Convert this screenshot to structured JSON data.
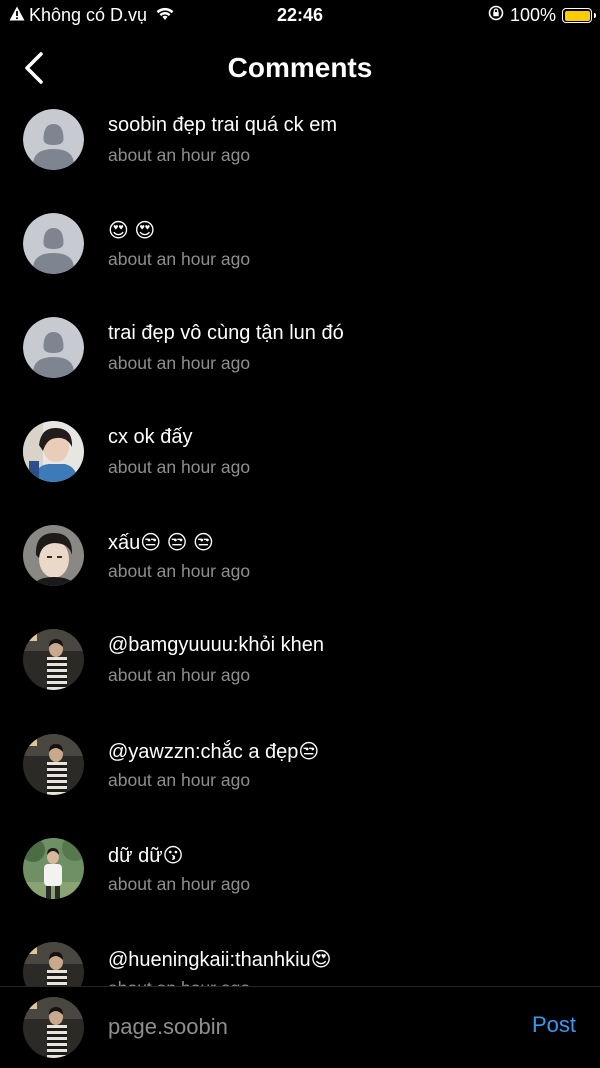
{
  "status_bar": {
    "carrier": "Không có D.vụ",
    "time": "22:46",
    "battery": "100%",
    "battery_level": 1.0,
    "battery_color": "#ffcc00"
  },
  "header": {
    "title": "Comments"
  },
  "comments": [
    {
      "text": "soobin đẹp trai quá ck em",
      "time": "about an hour ago",
      "avatar": "default-avatar"
    },
    {
      "text": "😍 😍",
      "time": "about an hour ago",
      "avatar": "default-avatar"
    },
    {
      "text": "trai đẹp vô cùng tận lun đó",
      "time": "about an hour ago",
      "avatar": "default-avatar"
    },
    {
      "text": "cx ok đấy",
      "time": "about an hour ago",
      "avatar": "photo-avatar"
    },
    {
      "text": "xấu😒 😒 😒",
      "time": "about an hour ago",
      "avatar": "photo-avatar"
    },
    {
      "text": "@bamgyuuuu:khỏi khen",
      "time": "about an hour ago",
      "avatar": "photo-avatar"
    },
    {
      "text": "@yawzzn:chắc a đẹp😒",
      "time": "about an hour ago",
      "avatar": "photo-avatar"
    },
    {
      "text": "dữ dữ😗",
      "time": "about an hour ago",
      "avatar": "photo-avatar"
    },
    {
      "text": "@hueningkaii:thanhkiu😍",
      "time": "about an hour ago",
      "avatar": "photo-avatar"
    }
  ],
  "composer": {
    "placeholder": "page.soobin",
    "post_label": "Post"
  },
  "colors": {
    "background": "#000000",
    "text": "#ffffff",
    "secondary_text": "#8e8e8e",
    "accent": "#3897f0"
  }
}
